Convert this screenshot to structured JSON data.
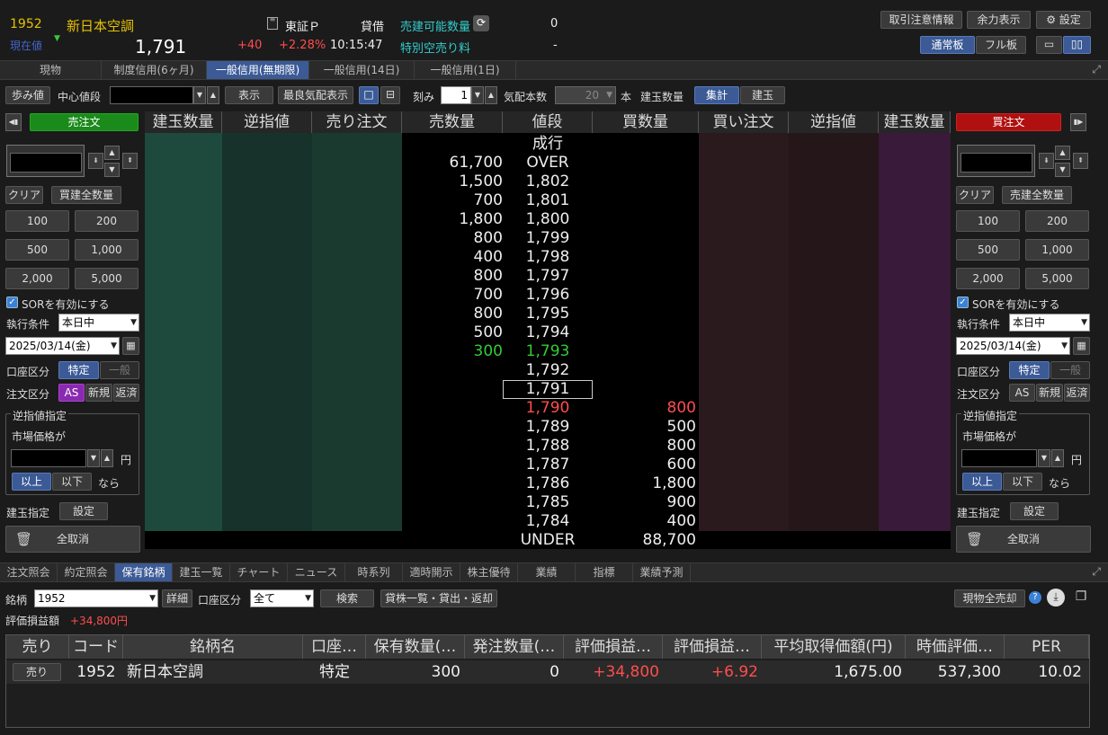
{
  "header": {
    "code": "1952",
    "name": "新日本空調",
    "current_label": "現在値",
    "price": "1,791",
    "change": "+40",
    "change_pct": "+2.28%",
    "time": "10:15:47",
    "market": "東証Ｐ",
    "lending_label": "貸借",
    "sell_qty_label": "売建可能数量",
    "sell_qty_value": "0",
    "special_fee_label": "特別空売り料",
    "special_fee_value": "-",
    "buttons": {
      "caution": "取引注意情報",
      "capacity": "余力表示",
      "settings": "設定",
      "normal_board": "通常板",
      "full_board": "フル板"
    }
  },
  "tabs": [
    "現物",
    "制度信用(6ヶ月)",
    "一般信用(無期限)",
    "一般信用(14日)",
    "一般信用(1日)"
  ],
  "active_tab": 2,
  "toolbar": {
    "steps": "歩み値",
    "center_label": "中心値段",
    "show": "表示",
    "best_quote": "最良気配表示",
    "tick_label": "刻み",
    "tick_value": "1",
    "quotes_label": "気配本数",
    "quotes_value": "20",
    "quotes_unit": "本",
    "position_qty_label": "建玉数量",
    "aggregate": "集計",
    "position": "建玉"
  },
  "sell_panel": {
    "title": "売注文",
    "clear": "クリア",
    "all_qty": "買建全数量",
    "qty_buttons": [
      "100",
      "200",
      "500",
      "1,000",
      "2,000",
      "5,000"
    ],
    "sor": "SORを有効にする",
    "exec_label": "執行条件",
    "exec_value": "本日中",
    "date": "2025/03/14(金)",
    "account_label": "口座区分",
    "account_specific": "特定",
    "account_general": "一般",
    "order_label": "注文区分",
    "order_as": "AS",
    "order_new": "新規",
    "order_return": "返済",
    "stop_title": "逆指値指定",
    "stop_market": "市場価格が",
    "yen": "円",
    "above": "以上",
    "below": "以下",
    "if": "なら",
    "position_label": "建玉指定",
    "position_set": "設定",
    "cancel_all": "全取消"
  },
  "buy_panel": {
    "title": "買注文",
    "clear": "クリア",
    "all_qty": "売建全数量",
    "qty_buttons": [
      "100",
      "200",
      "500",
      "1,000",
      "2,000",
      "5,000"
    ],
    "sor": "SORを有効にする",
    "exec_label": "執行条件",
    "exec_value": "本日中",
    "date": "2025/03/14(金)",
    "account_label": "口座区分",
    "account_specific": "特定",
    "account_general": "一般",
    "order_label": "注文区分",
    "order_as": "AS",
    "order_new": "新規",
    "order_return": "返済",
    "stop_title": "逆指値指定",
    "stop_market": "市場価格が",
    "yen": "円",
    "above": "以上",
    "below": "以下",
    "if": "なら",
    "position_label": "建玉指定",
    "position_set": "設定",
    "cancel_all": "全取消"
  },
  "book": {
    "headers": [
      "建玉数量",
      "逆指値",
      "売り注文",
      "売数量",
      "値段",
      "買数量",
      "買い注文",
      "逆指値",
      "建玉数量"
    ],
    "rows": [
      {
        "sell": "",
        "price": "成行",
        "buy": ""
      },
      {
        "sell": "61,700",
        "price": "OVER",
        "buy": ""
      },
      {
        "sell": "1,500",
        "price": "1,802",
        "buy": ""
      },
      {
        "sell": "700",
        "price": "1,801",
        "buy": ""
      },
      {
        "sell": "1,800",
        "price": "1,800",
        "buy": ""
      },
      {
        "sell": "800",
        "price": "1,799",
        "buy": ""
      },
      {
        "sell": "400",
        "price": "1,798",
        "buy": ""
      },
      {
        "sell": "800",
        "price": "1,797",
        "buy": ""
      },
      {
        "sell": "700",
        "price": "1,796",
        "buy": ""
      },
      {
        "sell": "800",
        "price": "1,795",
        "buy": ""
      },
      {
        "sell": "500",
        "price": "1,794",
        "buy": ""
      },
      {
        "sell": "300",
        "price": "1,793",
        "buy": ""
      },
      {
        "sell": "",
        "price": "1,792",
        "buy": ""
      },
      {
        "sell": "",
        "price": "1,791",
        "buy": ""
      },
      {
        "sell": "",
        "price": "1,790",
        "buy": "800"
      },
      {
        "sell": "",
        "price": "1,789",
        "buy": "500"
      },
      {
        "sell": "",
        "price": "1,788",
        "buy": "800"
      },
      {
        "sell": "",
        "price": "1,787",
        "buy": "600"
      },
      {
        "sell": "",
        "price": "1,786",
        "buy": "1,800"
      },
      {
        "sell": "",
        "price": "1,785",
        "buy": "900"
      },
      {
        "sell": "",
        "price": "1,784",
        "buy": "400"
      },
      {
        "sell": "",
        "price": "UNDER",
        "buy": "88,700"
      }
    ]
  },
  "bottom_tabs": [
    "注文照会",
    "約定照会",
    "保有銘柄",
    "建玉一覧",
    "チャート",
    "ニュース",
    "時系列",
    "適時開示",
    "株主優待",
    "業績",
    "指標",
    "業績予測"
  ],
  "active_bottom_tab": 2,
  "holdings": {
    "stock_label": "銘柄",
    "stock_value": "1952",
    "detail": "詳細",
    "account_label": "口座区分",
    "account_value": "全て",
    "search": "検索",
    "lending_list": "貸株一覧・貸出・返却",
    "sell_all": "現物全売却",
    "pl_label": "評価損益額",
    "pl_value": "+34,800円",
    "columns": [
      "売り",
      "コード",
      "銘柄名",
      "口座…",
      "保有数量(…",
      "発注数量(…",
      "評価損益…",
      "評価損益…",
      "平均取得価額(円)",
      "時価評価…",
      "PER"
    ],
    "row": {
      "sell": "売り",
      "code": "1952",
      "name": "新日本空調",
      "account": "特定",
      "qty": "300",
      "order_qty": "0",
      "pl": "+34,800",
      "pl_pct": "+6.92",
      "avg": "1,675.00",
      "value": "537,300",
      "per": "10.02"
    }
  },
  "colors": {
    "up": "#ff4d4d",
    "down_green": "#33cc33",
    "accent": "#3b5a96",
    "sell_green": "#1a8a1a",
    "buy_red": "#b01010",
    "code_yellow": "#e6c200"
  }
}
